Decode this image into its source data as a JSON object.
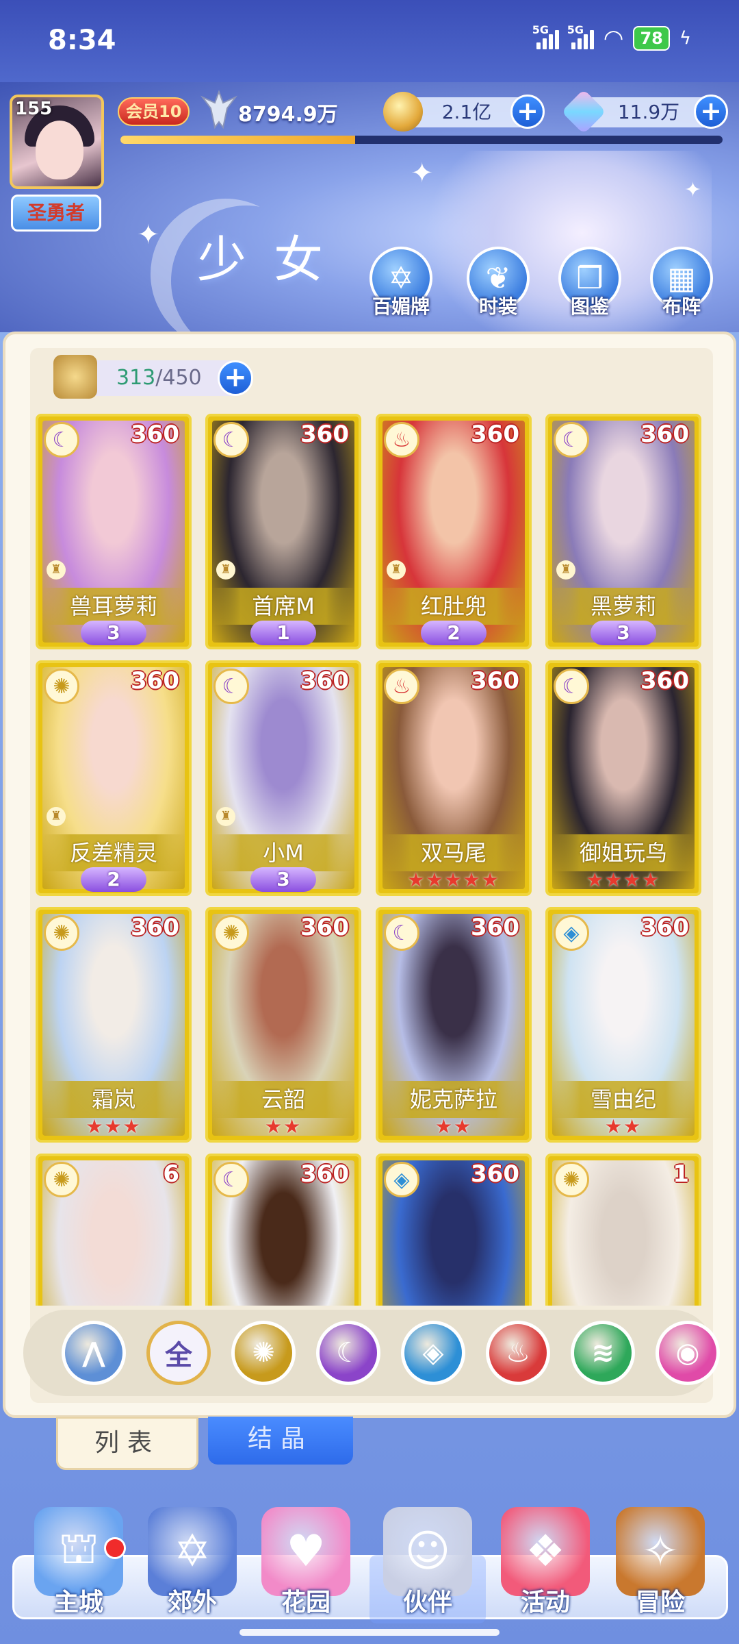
{
  "status": {
    "time": "8:34",
    "signal1": "5G",
    "signal2": "5G",
    "battery": "78"
  },
  "player": {
    "level": "155",
    "title": "圣勇者",
    "vip": "会员10",
    "power": "8794.9万",
    "exp_fraction": 0.39
  },
  "currency": {
    "gold": "2.1亿",
    "gem": "11.9万"
  },
  "page_title": "少女",
  "top_nav": [
    {
      "label": "百媚牌",
      "icon": "hexagram-icon"
    },
    {
      "label": "时装",
      "icon": "outfit-icon"
    },
    {
      "label": "图鉴",
      "icon": "book-icon"
    },
    {
      "label": "布阵",
      "icon": "grid-icon"
    }
  ],
  "inventory": {
    "current": "313",
    "max": "/450"
  },
  "cards": [
    {
      "name": "兽耳萝莉",
      "level": "360",
      "element": "moon",
      "badge": "3",
      "stars": 0,
      "colors": [
        "#c78bdc",
        "#f2c9d6"
      ]
    },
    {
      "name": "首席M",
      "level": "360",
      "element": "moon",
      "badge": "1",
      "stars": 0,
      "colors": [
        "#2c2630",
        "#b8a59a"
      ]
    },
    {
      "name": "红肚兜",
      "level": "360",
      "element": "fire",
      "badge": "2",
      "stars": 0,
      "colors": [
        "#d7353a",
        "#f3c4a8"
      ]
    },
    {
      "name": "黑萝莉",
      "level": "360",
      "element": "moon",
      "badge": "3",
      "stars": 0,
      "colors": [
        "#8a7bb8",
        "#e9d6e0"
      ]
    },
    {
      "name": "反差精灵",
      "level": "360",
      "element": "sun",
      "badge": "2",
      "stars": 0,
      "colors": [
        "#f6de8a",
        "#f7d9cf"
      ]
    },
    {
      "name": "小M",
      "level": "360",
      "element": "moon",
      "badge": "3",
      "stars": 0,
      "colors": [
        "#e4e2ef",
        "#9d8ad0"
      ]
    },
    {
      "name": "双马尾",
      "level": "360",
      "element": "fire",
      "badge": "",
      "stars": 5,
      "colors": [
        "#8a5a3a",
        "#f1c6b2"
      ]
    },
    {
      "name": "御姐玩鸟",
      "level": "360",
      "element": "moon",
      "badge": "",
      "stars": 4,
      "colors": [
        "#2a2430",
        "#d9b9b0"
      ]
    },
    {
      "name": "霜岚",
      "level": "360",
      "element": "sun",
      "badge": "",
      "stars": 3,
      "colors": [
        "#bcd3f2",
        "#f2ece6"
      ]
    },
    {
      "name": "云韶",
      "level": "360",
      "element": "sun",
      "badge": "",
      "stars": 2,
      "colors": [
        "#d9d3b8",
        "#b26a52"
      ]
    },
    {
      "name": "妮克萨拉",
      "level": "360",
      "element": "moon",
      "badge": "",
      "stars": 2,
      "colors": [
        "#b6bde6",
        "#3a3048"
      ]
    },
    {
      "name": "雪由纪",
      "level": "360",
      "element": "water",
      "badge": "",
      "stars": 2,
      "colors": [
        "#cfe3f2",
        "#f6f3f4"
      ]
    },
    {
      "name": "",
      "level": "6",
      "element": "sun",
      "badge": "",
      "stars": 0,
      "colors": [
        "#e7e4ea",
        "#f3dcd6"
      ]
    },
    {
      "name": "",
      "level": "360",
      "element": "moon",
      "badge": "",
      "stars": 0,
      "colors": [
        "#f0f0f4",
        "#4a2a1a"
      ]
    },
    {
      "name": "",
      "level": "360",
      "element": "water",
      "badge": "",
      "stars": 0,
      "colors": [
        "#3a6bd0",
        "#27306a"
      ]
    },
    {
      "name": "",
      "level": "1",
      "element": "sun",
      "badge": "",
      "stars": 0,
      "colors": [
        "#f4ede4",
        "#ddd2c8"
      ]
    }
  ],
  "filters": [
    {
      "id": "reset",
      "label": "",
      "color": "#5d8fd6"
    },
    {
      "id": "all",
      "label": "全",
      "color": "#5a4aa8"
    },
    {
      "id": "sun",
      "label": "",
      "color": "#c79a1c"
    },
    {
      "id": "moon",
      "label": "",
      "color": "#8b44c9"
    },
    {
      "id": "water",
      "label": "",
      "color": "#2d8fd6"
    },
    {
      "id": "fire",
      "label": "",
      "color": "#d93a3a"
    },
    {
      "id": "wind",
      "label": "",
      "color": "#2ea85a"
    },
    {
      "id": "star",
      "label": "",
      "color": "#e04aa8"
    }
  ],
  "tabs": {
    "list": "列表",
    "crystal": "结晶"
  },
  "bottom_nav": [
    {
      "label": "主城",
      "icon": "castle-icon",
      "color": "#6aa4f0"
    },
    {
      "label": "郊外",
      "icon": "portal-icon",
      "color": "#5b7fd8"
    },
    {
      "label": "花园",
      "icon": "heart-icon",
      "color": "#f28ac8"
    },
    {
      "label": "伙伴",
      "icon": "partner-icon",
      "color": "#c9cfe4"
    },
    {
      "label": "活动",
      "icon": "gift-icon",
      "color": "#f25a7a"
    },
    {
      "label": "冒险",
      "icon": "compass-icon",
      "color": "#c9782e"
    }
  ],
  "element_glyphs": {
    "moon": "☾",
    "sun": "✺",
    "fire": "♨",
    "water": "◈"
  }
}
